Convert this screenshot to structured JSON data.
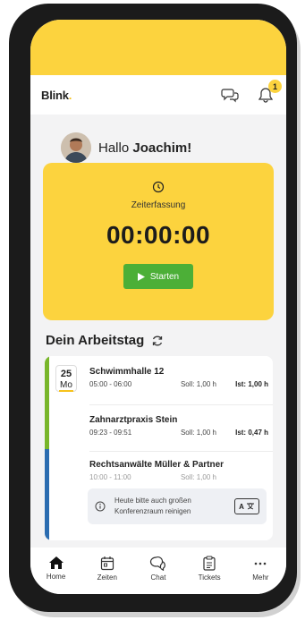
{
  "header": {
    "brand": "Blink",
    "brand_dot": ".",
    "notification_count": "1",
    "icons": [
      "chat-bubbles-icon",
      "bell-icon"
    ]
  },
  "greeting": {
    "prefix": "Hallo ",
    "name": "Joachim!"
  },
  "time_tracking": {
    "label": "Zeiterfassung",
    "timer": "00:00:00",
    "start_label": "Starten",
    "icon": "clock-icon"
  },
  "workday": {
    "title": "Dein Arbeitstag",
    "date": {
      "day": "25",
      "weekday": "Mo"
    },
    "entries": [
      {
        "title": "Schwimmhalle 12",
        "time": "05:00 - 06:00",
        "soll": "Soll: 1,00 h",
        "ist": "Ist: 1,00 h"
      },
      {
        "title": "Zahnarztpraxis Stein",
        "time": "09:23 - 09:51",
        "soll": "Soll: 1,00 h",
        "ist": "Ist: 0,47 h"
      },
      {
        "title": "Rechtsanwälte Müller & Partner",
        "time": "10:00 - 11:00",
        "soll": "Soll: 1,00 h",
        "ist": ""
      }
    ],
    "note": "Heute bitte auch großen Konferenzraum reinigen",
    "translate_label": "A"
  },
  "tabs": [
    {
      "label": "Home",
      "icon": "home-icon"
    },
    {
      "label": "Zeiten",
      "icon": "calendar-icon"
    },
    {
      "label": "Chat",
      "icon": "chat-icon"
    },
    {
      "label": "Tickets",
      "icon": "clipboard-icon"
    },
    {
      "label": "Mehr",
      "icon": "more-icon"
    }
  ],
  "colors": {
    "accent": "#fcd33e",
    "start_button": "#4caf37",
    "stripe_green": "#78b62a",
    "stripe_blue": "#2b6cb0"
  }
}
